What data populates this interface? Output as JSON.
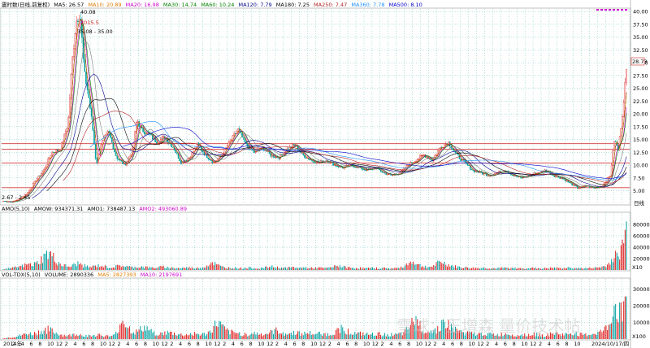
{
  "colors": {
    "background": "#ffffff",
    "grid": "#2ca7a2",
    "up": "#e02020",
    "down": "#00a0a0",
    "hline": "#d43a3a",
    "ma5": "#000000",
    "ma10": "#e07b00",
    "ma20": "#cc00cc",
    "ma30": "#008000",
    "ma60": "#808080",
    "ma120": "#00008b",
    "ma180": "#000000",
    "ma250": "#b22222",
    "ma360": "#1e90ff",
    "ma500": "#0000cd",
    "price_box": "#e06060"
  },
  "legend": {
    "stock": "震时数(日线,前复权)",
    "ma5": "MA5: 26.57",
    "ma10": "MA10: 20.89",
    "ma20": "MA20: 16.98",
    "ma30": "MA30: 14.74",
    "ma60": "MA60: 10.24",
    "ma120": "MA120: 7.79",
    "ma180": "MA180: 7.25",
    "ma250": "MA250: 7.47",
    "ma360": "MA360: 7.78",
    "ma500": "MA500: 8.10"
  },
  "annotations": {
    "peak_value": "40.08",
    "peak_date": "2015.5",
    "range": "35.08 - 35.00",
    "low": "2.67 - 2.45",
    "current_price": "28.73"
  },
  "amo_panel": {
    "label": "AMO(5,10)",
    "amow": "AMOW: 934371.31",
    "amo1": "AMO1: 738487.13",
    "amo2": "AMO2: 493060.89",
    "unit": "X10"
  },
  "vol_panel": {
    "label": "VOL-TDX(5,10)",
    "volume": "VOLUME: 2890336",
    "ma5": "MA5: 2827393",
    "ma10": "MA10: 2197691",
    "unit": "X100"
  },
  "right_label": "日线",
  "watermark": "雪球：王增森 量价技术帖",
  "chart_data": [
    {
      "type": "candlestick",
      "title": "",
      "y_ticks": [
        5.0,
        7.5,
        10.0,
        12.5,
        15.0,
        17.5,
        20.0,
        22.5,
        25.0,
        27.5,
        30.0,
        32.5,
        35.0,
        37.5,
        40.0
      ],
      "y_tick_labels": [
        "5.00",
        "7.50",
        "10.00",
        "12.50",
        "15.00",
        "17.50",
        "20.00",
        "22.50",
        "25.00",
        "27.50",
        "30.00",
        "32.50",
        "35.00",
        "37.50",
        "40.00"
      ],
      "ylim": [
        2.4,
        40.5
      ],
      "horizontal_lines": [
        14.2,
        13.1,
        10.4,
        5.6
      ],
      "price_path": [
        [
          0,
          3.0
        ],
        [
          2,
          2.8
        ],
        [
          4,
          3.4
        ],
        [
          6,
          4.6
        ],
        [
          8,
          7.0
        ],
        [
          10,
          9.0
        ],
        [
          12,
          12.5
        ],
        [
          14,
          13.0
        ],
        [
          16,
          18.0
        ],
        [
          17,
          30.0
        ],
        [
          18,
          38.0
        ],
        [
          19,
          40.08
        ],
        [
          20,
          28.0
        ],
        [
          21,
          24.0
        ],
        [
          22,
          18.0
        ],
        [
          23,
          10.0
        ],
        [
          24,
          14.0
        ],
        [
          26,
          16.5
        ],
        [
          28,
          11.5
        ],
        [
          30,
          10.0
        ],
        [
          32,
          13.0
        ],
        [
          33,
          19.0
        ],
        [
          34,
          17.0
        ],
        [
          36,
          16.0
        ],
        [
          38,
          14.5
        ],
        [
          40,
          15.5
        ],
        [
          42,
          13.5
        ],
        [
          44,
          10.5
        ],
        [
          46,
          11.5
        ],
        [
          48,
          14.0
        ],
        [
          50,
          12.0
        ],
        [
          52,
          10.5
        ],
        [
          54,
          12.0
        ],
        [
          56,
          14.5
        ],
        [
          58,
          17.0
        ],
        [
          60,
          14.0
        ],
        [
          62,
          12.5
        ],
        [
          64,
          13.5
        ],
        [
          66,
          12.0
        ],
        [
          68,
          11.5
        ],
        [
          70,
          13.0
        ],
        [
          72,
          14.0
        ],
        [
          74,
          12.0
        ],
        [
          76,
          11.0
        ],
        [
          78,
          10.5
        ],
        [
          80,
          11.0
        ],
        [
          82,
          10.0
        ],
        [
          84,
          9.5
        ],
        [
          86,
          10.0
        ],
        [
          88,
          9.5
        ],
        [
          90,
          9.0
        ],
        [
          92,
          9.5
        ],
        [
          94,
          8.5
        ],
        [
          96,
          8.0
        ],
        [
          98,
          8.5
        ],
        [
          100,
          10.0
        ],
        [
          102,
          11.0
        ],
        [
          104,
          12.0
        ],
        [
          106,
          11.0
        ],
        [
          108,
          13.5
        ],
        [
          110,
          14.5
        ],
        [
          112,
          12.0
        ],
        [
          114,
          10.5
        ],
        [
          116,
          9.0
        ],
        [
          118,
          8.5
        ],
        [
          120,
          8.0
        ],
        [
          122,
          8.5
        ],
        [
          124,
          9.0
        ],
        [
          126,
          8.0
        ],
        [
          128,
          7.5
        ],
        [
          130,
          8.0
        ],
        [
          132,
          8.5
        ],
        [
          134,
          9.0
        ],
        [
          136,
          8.0
        ],
        [
          138,
          7.5
        ],
        [
          140,
          6.5
        ],
        [
          142,
          5.5
        ],
        [
          144,
          6.0
        ],
        [
          146,
          5.5
        ],
        [
          148,
          6.0
        ],
        [
          150,
          8.0
        ],
        [
          151,
          15.0
        ],
        [
          152,
          13.0
        ],
        [
          153,
          20.0
        ],
        [
          154,
          28.73
        ]
      ]
    },
    {
      "type": "bar",
      "title": "",
      "y_ticks": [
        20000,
        40000,
        60000,
        80000
      ],
      "y_tick_labels": [
        "20000",
        "40000",
        "60000",
        "80000"
      ],
      "ylim": [
        0,
        100000
      ],
      "values": [
        1500,
        2200,
        3000,
        4500,
        6000,
        8000,
        10000,
        9000,
        12000,
        18000,
        25000,
        30000,
        22000,
        14000,
        9000,
        7000,
        6000,
        9000,
        12000,
        8000,
        6000,
        5000,
        7000,
        8000,
        6500,
        5000,
        4500,
        6000,
        8000,
        7000,
        5500,
        4500,
        5000,
        6000,
        5200,
        4200,
        3800,
        4500,
        5500,
        4800,
        3800,
        3500,
        3000,
        3600,
        4200,
        3800,
        3200,
        3800,
        5000,
        9000,
        14000,
        9000,
        6000,
        4500,
        4000,
        3800,
        3500,
        3200,
        3600,
        3800,
        3400,
        3000,
        3500,
        4500,
        6000,
        5000,
        4200,
        3500,
        3800,
        4500,
        4000,
        3600,
        4000,
        3600,
        3200,
        4000,
        3500,
        3000,
        4000,
        5500,
        8000,
        6000,
        4500,
        3800,
        3400,
        3600,
        3200,
        3000,
        3200,
        3400,
        3000,
        3200,
        3000,
        2800,
        3200,
        3600,
        8000,
        12000,
        16000,
        10000,
        7000,
        6000,
        5500,
        7000,
        12000,
        14000,
        10000,
        8000,
        6000,
        5000,
        4500,
        4000,
        3600,
        3200,
        3400,
        3800,
        3200,
        3000,
        2800,
        3200,
        3600,
        3200,
        3000,
        2800,
        3000,
        3200,
        3500,
        3200,
        3000,
        2600,
        3000,
        3400,
        3800,
        3200,
        3000,
        3600,
        4000,
        3400,
        3000,
        2800,
        3200,
        3600,
        4000,
        5000,
        7000,
        12000,
        28000,
        20000,
        45000,
        70000
      ]
    },
    {
      "type": "bar",
      "title": "",
      "y_ticks": [
        10000,
        20000,
        30000
      ],
      "y_tick_labels": [
        "10000",
        "20000",
        "30000"
      ],
      "ylim": [
        0,
        36000
      ],
      "values": [
        600,
        800,
        1000,
        1500,
        2000,
        2600,
        3200,
        3000,
        3600,
        4500,
        5200,
        5600,
        4400,
        3400,
        2600,
        2200,
        2000,
        2600,
        3200,
        2400,
        2000,
        1800,
        2200,
        2600,
        2200,
        1800,
        1600,
        2200,
        7000,
        12000,
        8000,
        5000,
        4000,
        5000,
        7000,
        6000,
        4000,
        3400,
        3000,
        3400,
        3800,
        3400,
        3000,
        2600,
        2400,
        2800,
        3400,
        3000,
        2600,
        3000,
        4200,
        7000,
        10000,
        7000,
        5000,
        4000,
        3600,
        3400,
        3000,
        2800,
        3200,
        3400,
        3000,
        2800,
        3200,
        4000,
        5000,
        4400,
        3600,
        3000,
        3400,
        4000,
        3600,
        3200,
        3600,
        3200,
        2800,
        3600,
        3000,
        2600,
        3600,
        4800,
        7000,
        5200,
        4000,
        3400,
        3000,
        3200,
        2800,
        2600,
        2800,
        3000,
        2600,
        2800,
        2600,
        2400,
        2800,
        3200,
        6000,
        9000,
        12000,
        8000,
        5600,
        5000,
        4600,
        5600,
        9000,
        10000,
        8000,
        6400,
        5000,
        4200,
        3800,
        3400,
        3000,
        2800,
        3000,
        3400,
        2800,
        2600,
        2400,
        2800,
        3200,
        2800,
        2600,
        2400,
        2600,
        2800,
        3000,
        2800,
        2600,
        2200,
        2600,
        3000,
        3400,
        2800,
        2600,
        3200,
        3600,
        3000,
        2600,
        2400,
        2800,
        3200,
        3600,
        4400,
        6000,
        9000,
        22000,
        14000,
        18000,
        30000
      ]
    }
  ],
  "x_axis": {
    "labels": [
      "2014年",
      "2",
      "4",
      "6",
      "8",
      "10",
      "12",
      "2",
      "4",
      "6",
      "8",
      "10",
      "12",
      "2",
      "4",
      "6",
      "8",
      "10",
      "12",
      "2",
      "4",
      "6",
      "8",
      "10",
      "12",
      "2",
      "4",
      "6",
      "8",
      "10",
      "12",
      "2",
      "4",
      "6",
      "8",
      "10",
      "12",
      "2",
      "4",
      "6",
      "8",
      "10",
      "12",
      "2",
      "4",
      "6",
      "8",
      "10",
      "12",
      "2",
      "4",
      "6",
      "8",
      "10",
      "12",
      "2",
      "4",
      "6",
      "8",
      "10",
      "12",
      "2",
      "4",
      "6",
      "8",
      "10",
      "2024/10/17/四"
    ]
  }
}
